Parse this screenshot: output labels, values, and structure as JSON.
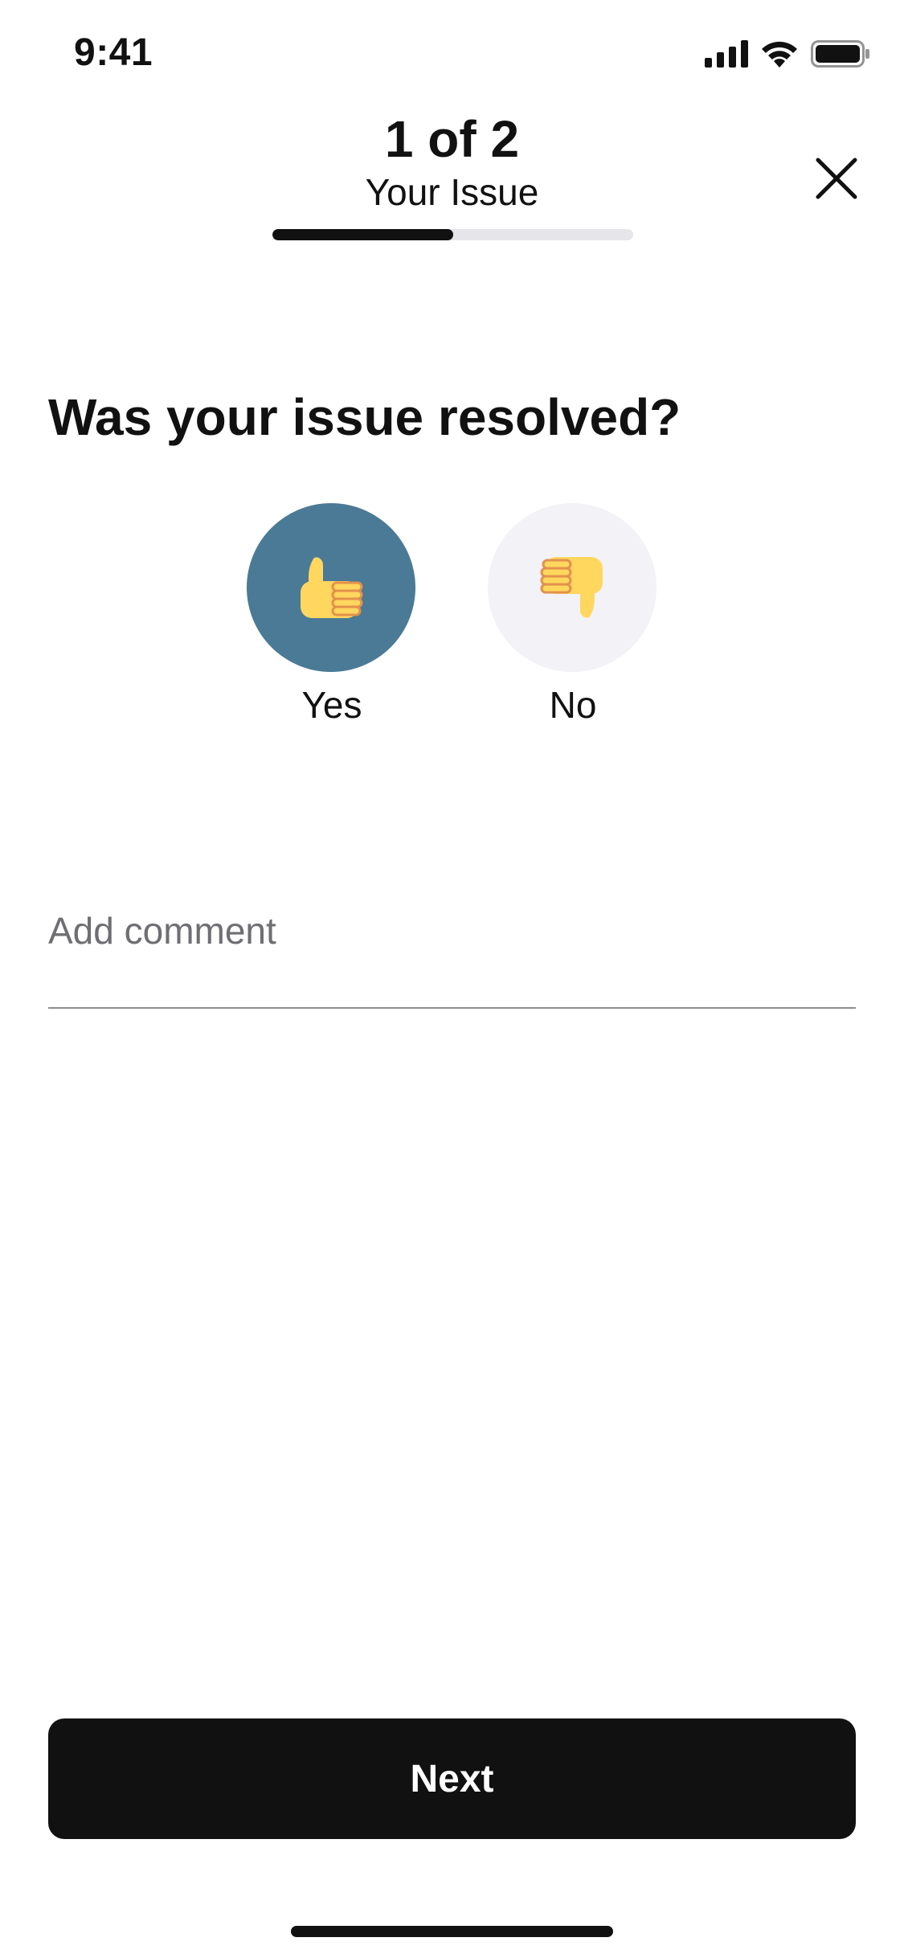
{
  "status_bar": {
    "time": "9:41"
  },
  "header": {
    "step": "1 of 2",
    "subtitle": "Your Issue",
    "progress": 0.5
  },
  "question": "Was your issue resolved?",
  "choices": [
    {
      "label": "Yes",
      "icon": "thumbs-up-icon",
      "selected": true,
      "color": "#4a7a96"
    },
    {
      "label": "No",
      "icon": "thumbs-down-icon",
      "selected": false,
      "color": "#f2f2f7"
    }
  ],
  "comment": {
    "placeholder": "Add comment",
    "value": ""
  },
  "next_button": {
    "label": "Next"
  },
  "colors": {
    "accent": "#4a7a96",
    "primary": "#111111",
    "emoji_yellow": "#ffd75e",
    "emoji_orange": "#e3914c"
  }
}
